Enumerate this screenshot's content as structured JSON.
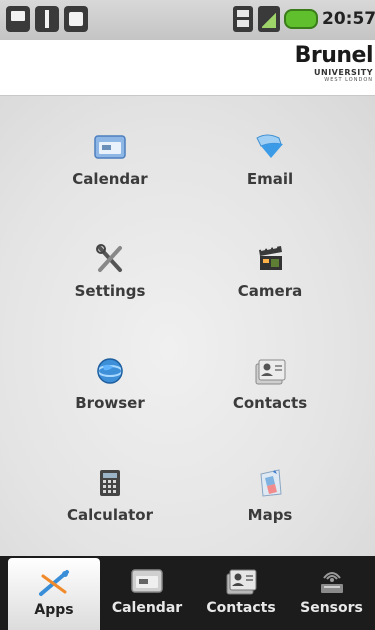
{
  "status_bar": {
    "time": "20:57",
    "icons": [
      "photo-icon",
      "usb-icon",
      "sd-card-icon",
      "data-transfer-icon",
      "signal-icon",
      "battery-icon"
    ],
    "battery_color": "#5fbf2d"
  },
  "header": {
    "brand_name": "Brunel",
    "brand_sub": "UNIVERSITY",
    "brand_sub2": "WEST LONDON"
  },
  "apps": [
    {
      "label": "Calendar",
      "icon": "calendar-icon"
    },
    {
      "label": "Email",
      "icon": "email-icon"
    },
    {
      "label": "Settings",
      "icon": "settings-icon"
    },
    {
      "label": "Camera",
      "icon": "camera-icon"
    },
    {
      "label": "Browser",
      "icon": "browser-icon"
    },
    {
      "label": "Contacts",
      "icon": "contacts-icon"
    },
    {
      "label": "Calculator",
      "icon": "calculator-icon"
    },
    {
      "label": "Maps",
      "icon": "maps-icon"
    }
  ],
  "tabs": [
    {
      "label": "Apps",
      "icon": "apps-icon",
      "active": true
    },
    {
      "label": "Calendar",
      "icon": "calendar-icon",
      "active": false
    },
    {
      "label": "Contacts",
      "icon": "contacts-icon",
      "active": false
    },
    {
      "label": "Sensors",
      "icon": "sensors-icon",
      "active": false
    }
  ],
  "colors": {
    "tab_bar_bg": "#1c1c1c",
    "active_tab_bg": "#ffffff",
    "label_text": "#3b3b3b"
  }
}
